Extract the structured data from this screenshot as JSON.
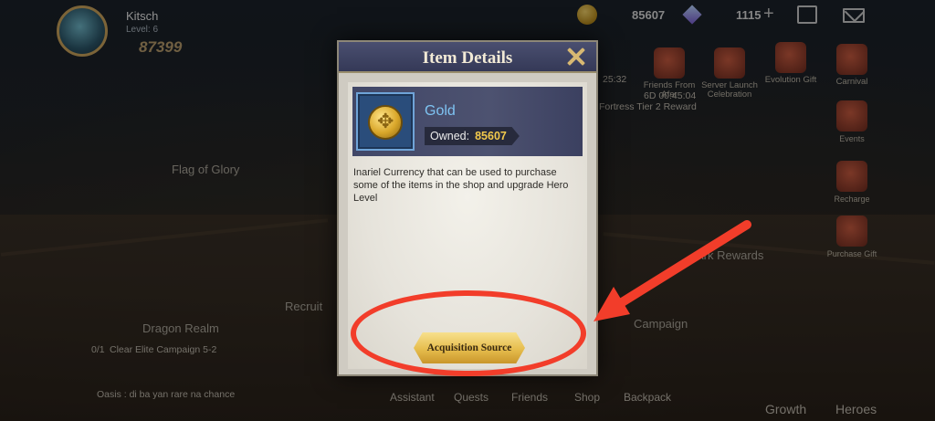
{
  "hud": {
    "player_name": "Kitsch",
    "level": "Level: 6",
    "power": "87399",
    "gold": "85607",
    "gems": "1115",
    "plus": "+"
  },
  "events": [
    {
      "label": "Friends From Afar"
    },
    {
      "label": "Server Launch Celebration"
    },
    {
      "label": "Evolution Gift"
    },
    {
      "label": "Carnival"
    },
    {
      "label": "Events"
    },
    {
      "label": "Recharge"
    },
    {
      "label": "Purchase Gift"
    }
  ],
  "event_timer": "6D 00:45:04",
  "timer_left": "25:32",
  "fortress_reward": "Fortress Tier 2 Reward",
  "scene_labels": {
    "flag_of_glory": "Flag of Glory",
    "recruit": "Recruit",
    "dragon_realm": "Dragon Realm",
    "campaign": "Campaign",
    "ark_rewards": "Ark Rewards"
  },
  "quest": {
    "progress": "0/1",
    "text": "Clear Elite Campaign 5-2"
  },
  "chat": {
    "line": "Oasis : di ba yan rare na chance"
  },
  "bottom_nav": [
    "Assistant",
    "Quests",
    "Friends",
    "Shop",
    "Backpack"
  ],
  "side_nav": [
    "Growth",
    "Heroes"
  ],
  "modal": {
    "title": "Item Details",
    "item_name": "Gold",
    "owned_label": "Owned:",
    "owned_value": "85607",
    "description": "Inariel Currency that can be used to purchase some of the items in the shop and upgrade Hero Level",
    "acquisition_button": "Acquisition Source"
  },
  "colors": {
    "annotation": "#f23d2a",
    "button_gold": "#e6bd4d",
    "item_name": "#7ec3f2"
  },
  "icons": [
    "gold-coin-icon",
    "gem-icon",
    "mail-icon",
    "clipboard-icon",
    "close-icon"
  ]
}
